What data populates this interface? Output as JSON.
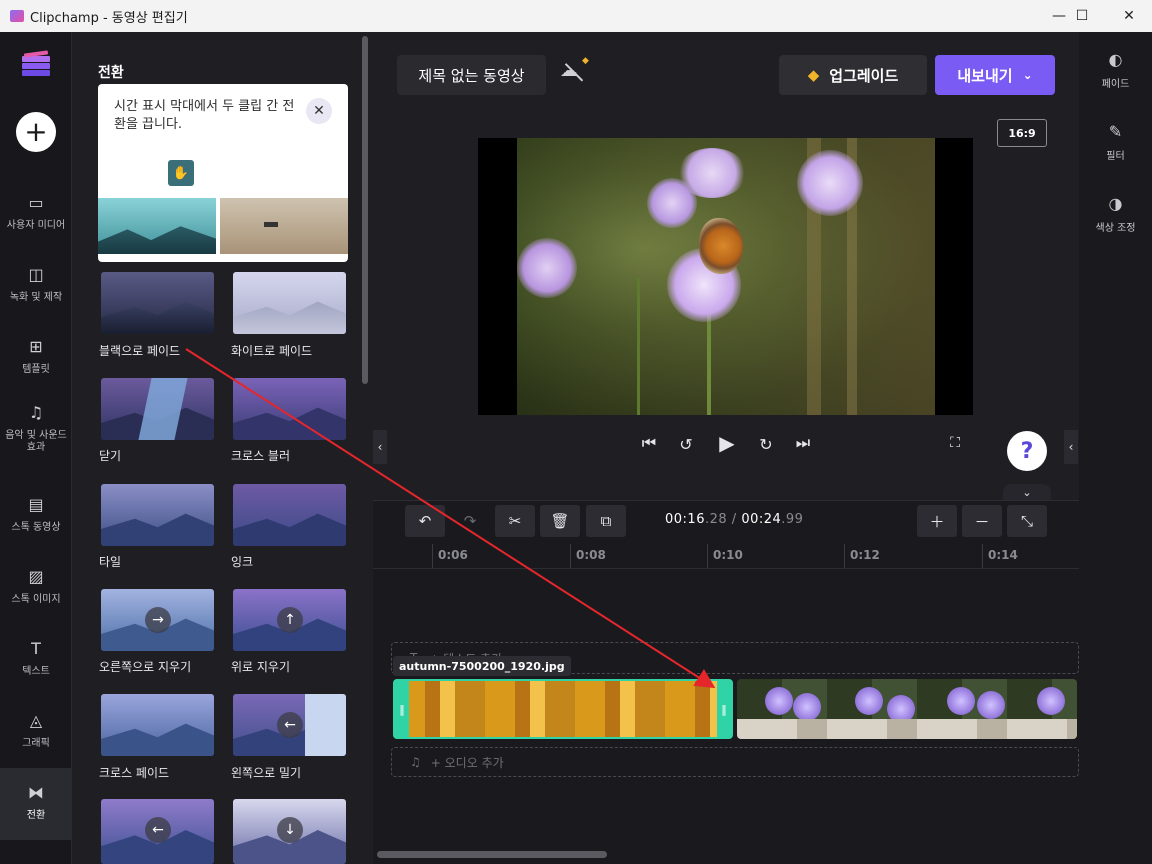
{
  "window": {
    "title": "Clipchamp - 동영상 편집기",
    "min": "—",
    "max": "☐",
    "close": "✕"
  },
  "rail": {
    "items": [
      {
        "label": "사용자 미디어",
        "icon": "folder-icon"
      },
      {
        "label": "녹화 및 제작",
        "icon": "camera-icon"
      },
      {
        "label": "템플릿",
        "icon": "templates-icon"
      },
      {
        "label": "음악 및 사운드 효과",
        "icon": "music-icon"
      },
      {
        "label": "스톡 동영상",
        "icon": "film-icon"
      },
      {
        "label": "스톡 이미지",
        "icon": "image-icon"
      },
      {
        "label": "텍스트",
        "icon": "text-icon"
      },
      {
        "label": "그래픽",
        "icon": "shapes-icon"
      },
      {
        "label": "전환",
        "icon": "transition-icon"
      }
    ],
    "active": "전환"
  },
  "panel": {
    "title": "전환",
    "tip": "시간 표시 막대에서 두 클립 간 전환을 끕니다.",
    "transitions": [
      {
        "label": "블랙으로 페이드"
      },
      {
        "label": "화이트로 페이드"
      },
      {
        "label": "닫기"
      },
      {
        "label": "크로스 블러"
      },
      {
        "label": "타일"
      },
      {
        "label": "잉크"
      },
      {
        "label": "오른쪽으로 지우기",
        "glyph": "→"
      },
      {
        "label": "위로 지우기",
        "glyph": "↑"
      },
      {
        "label": "크로스 페이드"
      },
      {
        "label": "왼쪽으로 밀기",
        "glyph": "←"
      },
      {
        "label": "",
        "glyph": "←"
      },
      {
        "label": "",
        "glyph": "↓"
      }
    ]
  },
  "topbar": {
    "project_title": "제목 없는 동영상",
    "upgrade_label": "업그레이드",
    "export_label": "내보내기"
  },
  "preview": {
    "aspect_ratio": "16:9"
  },
  "right_rail": {
    "items": [
      {
        "label": "페이드",
        "icon": "fade-icon"
      },
      {
        "label": "필터",
        "icon": "magic-wand-icon"
      },
      {
        "label": "색상 조정",
        "icon": "contrast-icon"
      }
    ]
  },
  "timeline": {
    "current_time": "00:16",
    "current_frac": ".28",
    "total_time": "00:24",
    "total_frac": ".99",
    "ticks": [
      "0:06",
      "0:08",
      "0:10",
      "0:12",
      "0:14"
    ],
    "text_lane": "+ 텍스트 추가",
    "audio_lane": "+ 오디오 추가",
    "clip_name": "autumn-7500200_1920.jpg"
  },
  "colors": {
    "accent": "#7a5cf5",
    "clip_selected": "#2fd3a6",
    "annotation_arrow": "#e5262b"
  }
}
